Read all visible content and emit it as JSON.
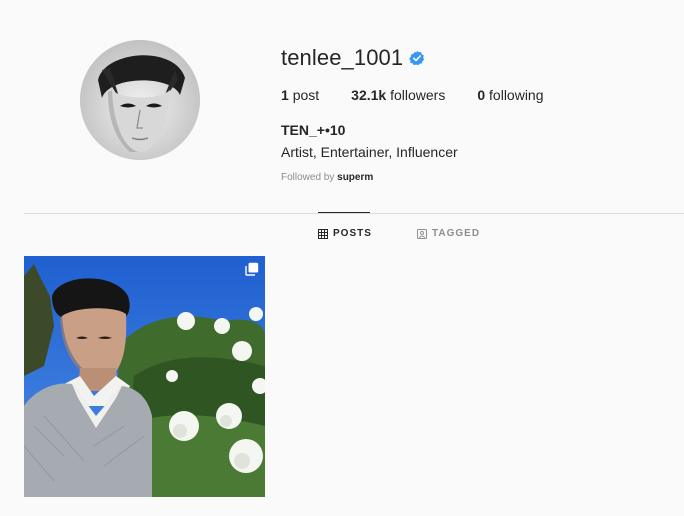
{
  "profile": {
    "username": "tenlee_1001",
    "verified": true,
    "stats": {
      "posts_count": "1",
      "posts_label": "post",
      "followers_count": "32.1k",
      "followers_label": "followers",
      "following_count": "0",
      "following_label": "following"
    },
    "full_name": "TEN_+•10",
    "bio": "Artist, Entertainer, Influencer",
    "followed_by_prefix": "Followed by",
    "followed_by_user": "superm"
  },
  "tabs": [
    {
      "label": "POSTS",
      "icon": "grid-icon",
      "active": true
    },
    {
      "label": "TAGGED",
      "icon": "tag-icon",
      "active": false
    }
  ],
  "posts": [
    {
      "type": "carousel",
      "icon": "multiple-posts-icon"
    }
  ],
  "colors": {
    "background": "#fafafa",
    "text": "#262626",
    "muted": "#8e8e8e",
    "verified_blue": "#3897f0",
    "divider": "#dbdbdb"
  }
}
